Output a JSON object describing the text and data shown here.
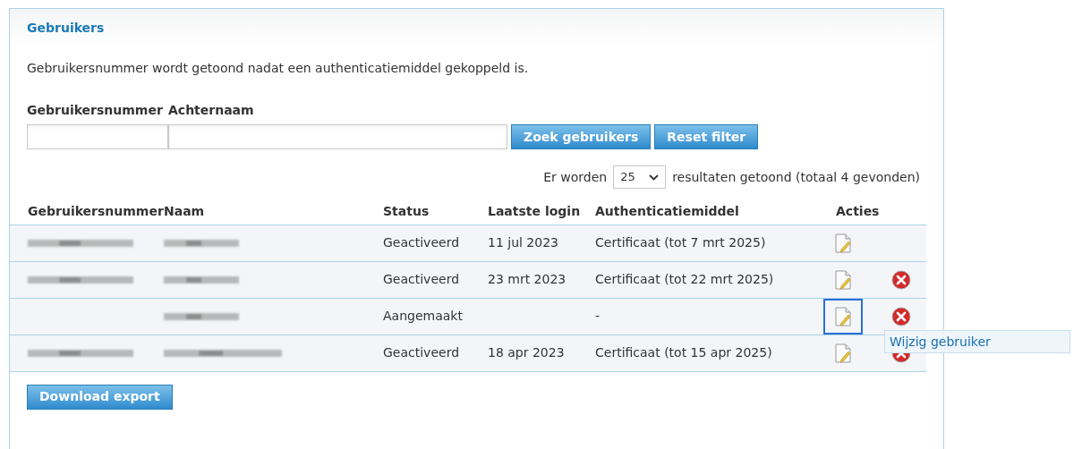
{
  "panel": {
    "title": "Gebruikers",
    "info": "Gebruikersnummer wordt getoond nadat een authenticatiemiddel gekoppeld is."
  },
  "filters": {
    "fields": [
      {
        "label": "Gebruikersnummer",
        "kind": "small"
      },
      {
        "label": "Achternaam",
        "kind": "wide"
      }
    ],
    "buttons": [
      "Zoek gebruikers",
      "Reset filter"
    ]
  },
  "paging": {
    "before": "Er worden",
    "page_size": "25",
    "after": "resultaten getoond (totaal 4 gevonden)"
  },
  "table": {
    "columns": [
      "Gebruikersnummer",
      "Naam",
      "Status",
      "Laatste login",
      "Authenticatiemiddel",
      "Acties"
    ],
    "rows": [
      {
        "number_blurred": true,
        "name_blurred": true,
        "status": "Geactiveerd",
        "last_login": "11 jul 2023",
        "auth": "Certificaat (tot 7 mrt 2025)",
        "deletable": false,
        "focused": false
      },
      {
        "number_blurred": true,
        "name_blurred": true,
        "status": "Geactiveerd",
        "last_login": "23 mrt 2023",
        "auth": "Certificaat (tot 22 mrt 2025)",
        "deletable": true,
        "focused": false
      },
      {
        "number_blurred": false,
        "name_blurred": true,
        "status": "Aangemaakt",
        "auth": "-",
        "deletable": true,
        "focused": true,
        "tooltip": "Wijzig gebruiker"
      },
      {
        "number_blurred": true,
        "name_blurred": true,
        "status": "Geactiveerd",
        "last_login": "18 apr 2023",
        "auth": "Certificaat (tot 15 apr 2025)",
        "deletable": true,
        "focused": false
      }
    ]
  },
  "export_button": "Download export"
}
